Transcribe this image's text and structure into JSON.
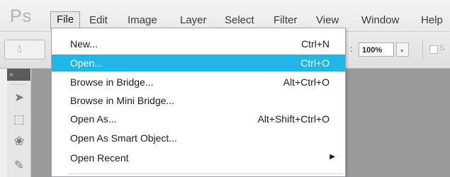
{
  "app": {
    "logo": "Ps"
  },
  "menubar": {
    "items": [
      {
        "label": "File"
      },
      {
        "label": "Edit"
      },
      {
        "label": "Image"
      },
      {
        "label": "Layer"
      },
      {
        "label": "Select"
      },
      {
        "label": "Filter"
      },
      {
        "label": "View"
      },
      {
        "label": "Window"
      },
      {
        "label": "Help"
      }
    ]
  },
  "options_bar": {
    "zoom_label": ":",
    "zoom_value": "100%",
    "stepper_arrow": "▸",
    "checkbox_label": "S"
  },
  "tools_panel": {
    "collapse_glyph": "»"
  },
  "file_menu": {
    "items": [
      {
        "label": "New...",
        "shortcut": "Ctrl+N",
        "highlighted": false
      },
      {
        "label": "Open...",
        "shortcut": "Ctrl+O",
        "highlighted": true
      },
      {
        "label": "Browse in Bridge...",
        "shortcut": "Alt+Ctrl+O",
        "highlighted": false
      },
      {
        "label": "Browse in Mini Bridge...",
        "shortcut": "",
        "highlighted": false
      },
      {
        "label": "Open As...",
        "shortcut": "Alt+Shift+Ctrl+O",
        "highlighted": false
      },
      {
        "label": "Open As Smart Object...",
        "shortcut": "",
        "highlighted": false
      },
      {
        "label": "Open Recent",
        "shortcut": "",
        "highlighted": false,
        "submenu": true
      }
    ]
  },
  "colors": {
    "highlight": "#20b7e6",
    "canvas": "#9a9a9a"
  }
}
